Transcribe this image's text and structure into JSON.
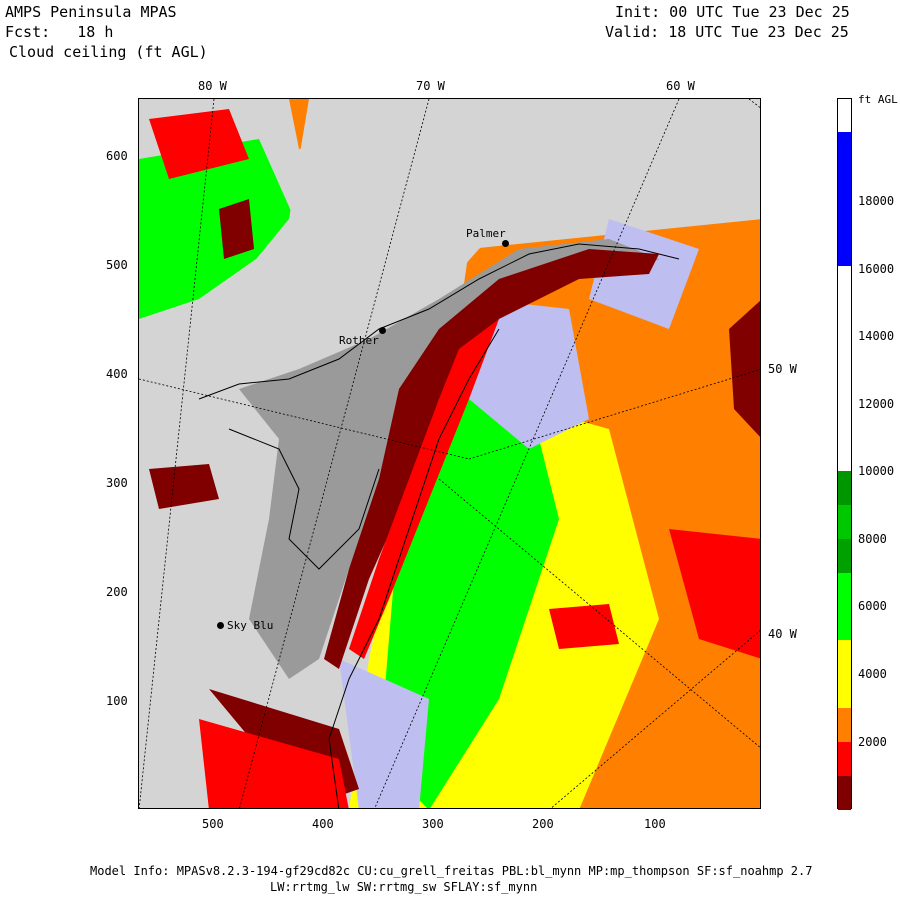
{
  "header": {
    "title": "AMPS Peninsula MPAS",
    "fcst": "Fcst:   18 h",
    "field": "Cloud ceiling (ft AGL)",
    "init": "Init: 00 UTC Tue 23 Dec 25",
    "valid": "Valid: 18 UTC Tue 23 Dec 25"
  },
  "axes": {
    "top_lon": [
      "80 W",
      "70 W",
      "60 W"
    ],
    "right_lon": [
      "50 W",
      "40 W"
    ],
    "left_y": [
      "600",
      "500",
      "400",
      "300",
      "200",
      "100"
    ],
    "bottom_x": [
      "500",
      "400",
      "300",
      "200",
      "100"
    ]
  },
  "stations": [
    {
      "name": "Palmer"
    },
    {
      "name": "Rother"
    },
    {
      "name": "Sky Blu"
    }
  ],
  "colorbar": {
    "unit": "ft AGL",
    "labels": [
      "18000",
      "16000",
      "14000",
      "12000",
      "10000",
      "8000",
      "6000",
      "4000",
      "2000"
    ],
    "colors": {
      "c0": "#800000",
      "c1": "#ff0000",
      "c2": "#ff8000",
      "c3": "#ffff00",
      "c4": "#00ff00",
      "c5": "#00c800",
      "c6": "#009600",
      "c7": "#ffffff",
      "c8": "#0000ff"
    }
  },
  "map_colors": {
    "land": "#d4d4d4",
    "lavender": "#bebef0",
    "terrain_dark": "#6e6e6e"
  },
  "footer": {
    "line1": "Model Info: MPASv8.2.3-194-gf29cd82c CU:cu_grell_freitas PBL:bl_mynn MP:mp_thompson SF:sf_noahmp 2.7",
    "line2": "LW:rrtmg_lw SW:rrtmg_sw SFLAY:sf_mynn"
  }
}
